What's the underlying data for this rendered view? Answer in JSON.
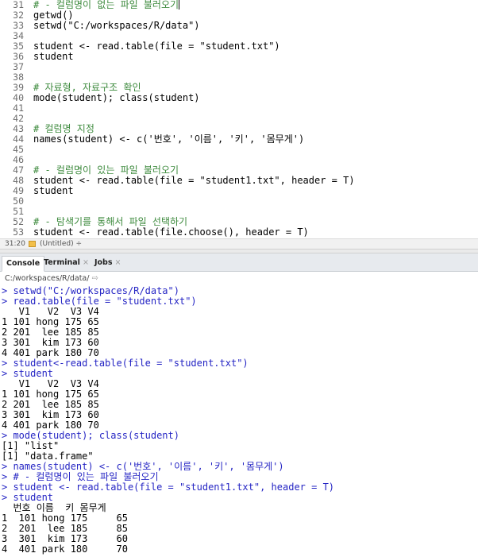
{
  "editor": {
    "lines": [
      {
        "num": "31",
        "text": "# - 컬럼명이 없는 파일 불러오기",
        "type": "comment",
        "cursor": true
      },
      {
        "num": "32",
        "text": "getwd()",
        "type": "code"
      },
      {
        "num": "33",
        "text": "setwd(\"C:/workspaces/R/data\")",
        "type": "code"
      },
      {
        "num": "34",
        "text": "",
        "type": "code"
      },
      {
        "num": "35",
        "text": "student <- read.table(file = \"student.txt\")",
        "type": "code"
      },
      {
        "num": "36",
        "text": "student",
        "type": "code"
      },
      {
        "num": "37",
        "text": "",
        "type": "code"
      },
      {
        "num": "38",
        "text": "",
        "type": "code"
      },
      {
        "num": "39",
        "text": "# 자료형, 자료구조 확인",
        "type": "comment"
      },
      {
        "num": "40",
        "text": "mode(student); class(student)",
        "type": "code"
      },
      {
        "num": "41",
        "text": "",
        "type": "code"
      },
      {
        "num": "42",
        "text": "",
        "type": "code"
      },
      {
        "num": "43",
        "text": "# 컬럼명 지정",
        "type": "comment"
      },
      {
        "num": "44",
        "text": "names(student) <- c('번호', '이름', '키', '몸무게')",
        "type": "code"
      },
      {
        "num": "45",
        "text": "",
        "type": "code"
      },
      {
        "num": "46",
        "text": "",
        "type": "code"
      },
      {
        "num": "47",
        "text": "# - 컬럼명이 있는 파일 불러오기",
        "type": "comment"
      },
      {
        "num": "48",
        "text": "student <- read.table(file = \"student1.txt\", header = T)",
        "type": "code"
      },
      {
        "num": "49",
        "text": "student",
        "type": "code"
      },
      {
        "num": "50",
        "text": "",
        "type": "code"
      },
      {
        "num": "51",
        "text": "",
        "type": "code"
      },
      {
        "num": "52",
        "text": "# - 탐색기를 통해서 파일 선택하기",
        "type": "comment"
      },
      {
        "num": "53",
        "text": "student <- read.table(file.choose(), header = T)",
        "type": "code"
      }
    ],
    "status": {
      "position": "31:20",
      "scope": "(Untitled) ÷"
    }
  },
  "tabs": [
    {
      "label": "Console",
      "active": true,
      "closable": false
    },
    {
      "label": "Terminal",
      "active": false,
      "closable": true
    },
    {
      "label": "Jobs",
      "active": false,
      "closable": true
    }
  ],
  "console": {
    "path": "C:/workspaces/R/data/",
    "lines": [
      {
        "text": "> setwd(\"C:/workspaces/R/data\")",
        "type": "cmd"
      },
      {
        "text": "> read.table(file = \"student.txt\")",
        "type": "cmd"
      },
      {
        "text": "   V1   V2  V3 V4",
        "type": "out"
      },
      {
        "text": "1 101 hong 175 65",
        "type": "out"
      },
      {
        "text": "2 201  lee 185 85",
        "type": "out"
      },
      {
        "text": "3 301  kim 173 60",
        "type": "out"
      },
      {
        "text": "4 401 park 180 70",
        "type": "out"
      },
      {
        "text": "> student<-read.table(file = \"student.txt\")",
        "type": "cmd"
      },
      {
        "text": "> student",
        "type": "cmd"
      },
      {
        "text": "   V1   V2  V3 V4",
        "type": "out"
      },
      {
        "text": "1 101 hong 175 65",
        "type": "out"
      },
      {
        "text": "2 201  lee 185 85",
        "type": "out"
      },
      {
        "text": "3 301  kim 173 60",
        "type": "out"
      },
      {
        "text": "4 401 park 180 70",
        "type": "out"
      },
      {
        "text": "> mode(student); class(student)",
        "type": "cmd"
      },
      {
        "text": "[1] \"list\"",
        "type": "out"
      },
      {
        "text": "[1] \"data.frame\"",
        "type": "out"
      },
      {
        "text": "> names(student) <- c('번호', '이름', '키', '몸무게')",
        "type": "cmd"
      },
      {
        "text": "> # - 컬럼명이 있는 파일 불러오기",
        "type": "cmd"
      },
      {
        "text": "> student <- read.table(file = \"student1.txt\", header = T)",
        "type": "cmd"
      },
      {
        "text": "> student",
        "type": "cmd"
      },
      {
        "text": "  번호 이름  키 몸무게",
        "type": "out"
      },
      {
        "text": "1  101 hong 175     65",
        "type": "out"
      },
      {
        "text": "2  201  lee 185     85",
        "type": "out"
      },
      {
        "text": "3  301  kim 173     60",
        "type": "out"
      },
      {
        "text": "4  401 park 180     70",
        "type": "out"
      }
    ]
  }
}
